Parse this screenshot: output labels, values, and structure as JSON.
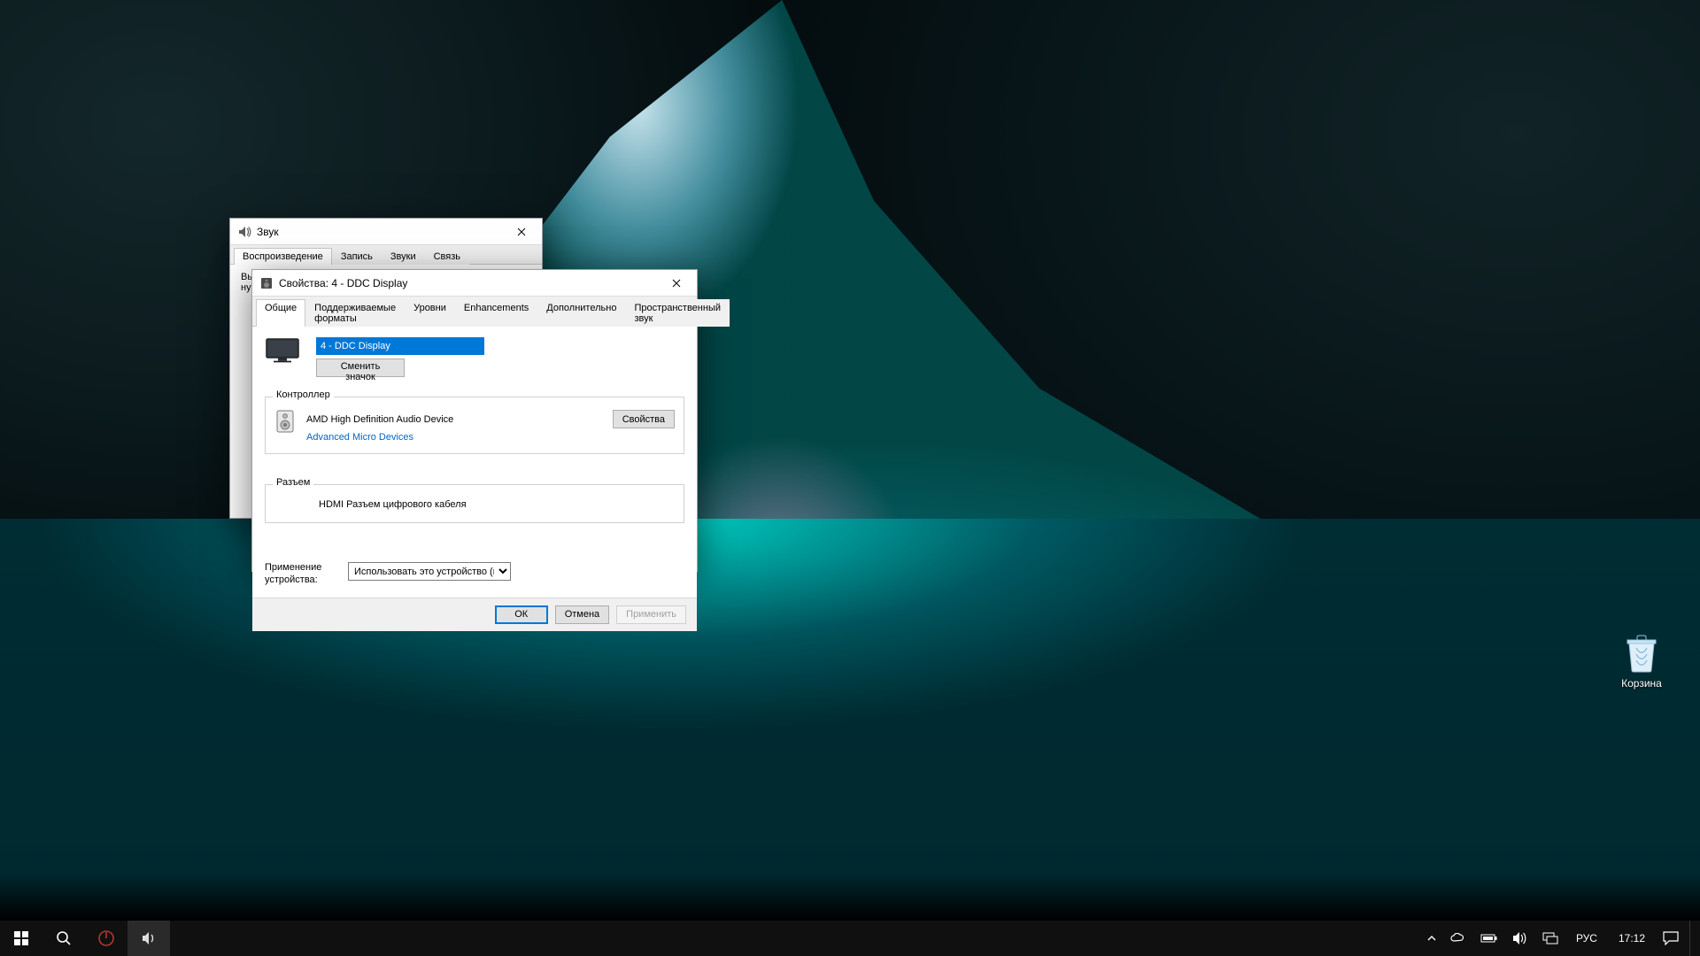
{
  "desktop": {
    "recycle_bin_label": "Корзина"
  },
  "sound_window": {
    "title": "Звук",
    "tabs": [
      "Воспроизведение",
      "Запись",
      "Звуки",
      "Связь"
    ],
    "active_tab": 0,
    "description": "Выберите устройство воспроизведения, параметры которого нужно из"
  },
  "props_window": {
    "title": "Свойства: 4 - DDC Display",
    "tabs": [
      "Общие",
      "Поддерживаемые форматы",
      "Уровни",
      "Enhancements",
      "Дополнительно",
      "Пространственный звук"
    ],
    "active_tab": 0,
    "device_name_input": "4 - DDC Display",
    "change_icon_btn": "Сменить значок",
    "controller_group": "Контроллер",
    "controller_name": "AMD High Definition Audio Device",
    "controller_vendor": "Advanced Micro Devices",
    "controller_props_btn": "Свойства",
    "jack_group": "Разъем",
    "jack_text": "HDMI Разъем цифрового кабеля",
    "device_usage_label": "Применение устройства:",
    "device_usage_value": "Использовать это устройство (вкл.)",
    "buttons": {
      "ok": "ОК",
      "cancel": "Отмена",
      "apply": "Применить"
    }
  },
  "taskbar": {
    "lang": "РУС",
    "time": "17:12"
  }
}
